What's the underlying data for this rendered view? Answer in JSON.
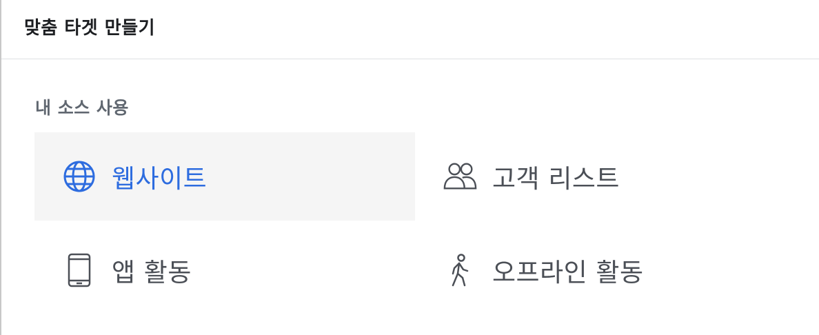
{
  "dialog": {
    "title": "맞춤 타겟 만들기"
  },
  "section": {
    "label": "내 소스 사용"
  },
  "options": [
    {
      "label": "웹사이트",
      "icon": "globe-icon",
      "selected": true
    },
    {
      "label": "고객 리스트",
      "icon": "people-icon",
      "selected": false
    },
    {
      "label": "앱 활동",
      "icon": "mobile-phone-icon",
      "selected": false
    },
    {
      "label": "오프라인 활동",
      "icon": "walking-person-icon",
      "selected": false
    }
  ],
  "colors": {
    "accent": "#2d6cdf",
    "text": "#4b4f56",
    "selected_bg": "#f5f5f5"
  }
}
